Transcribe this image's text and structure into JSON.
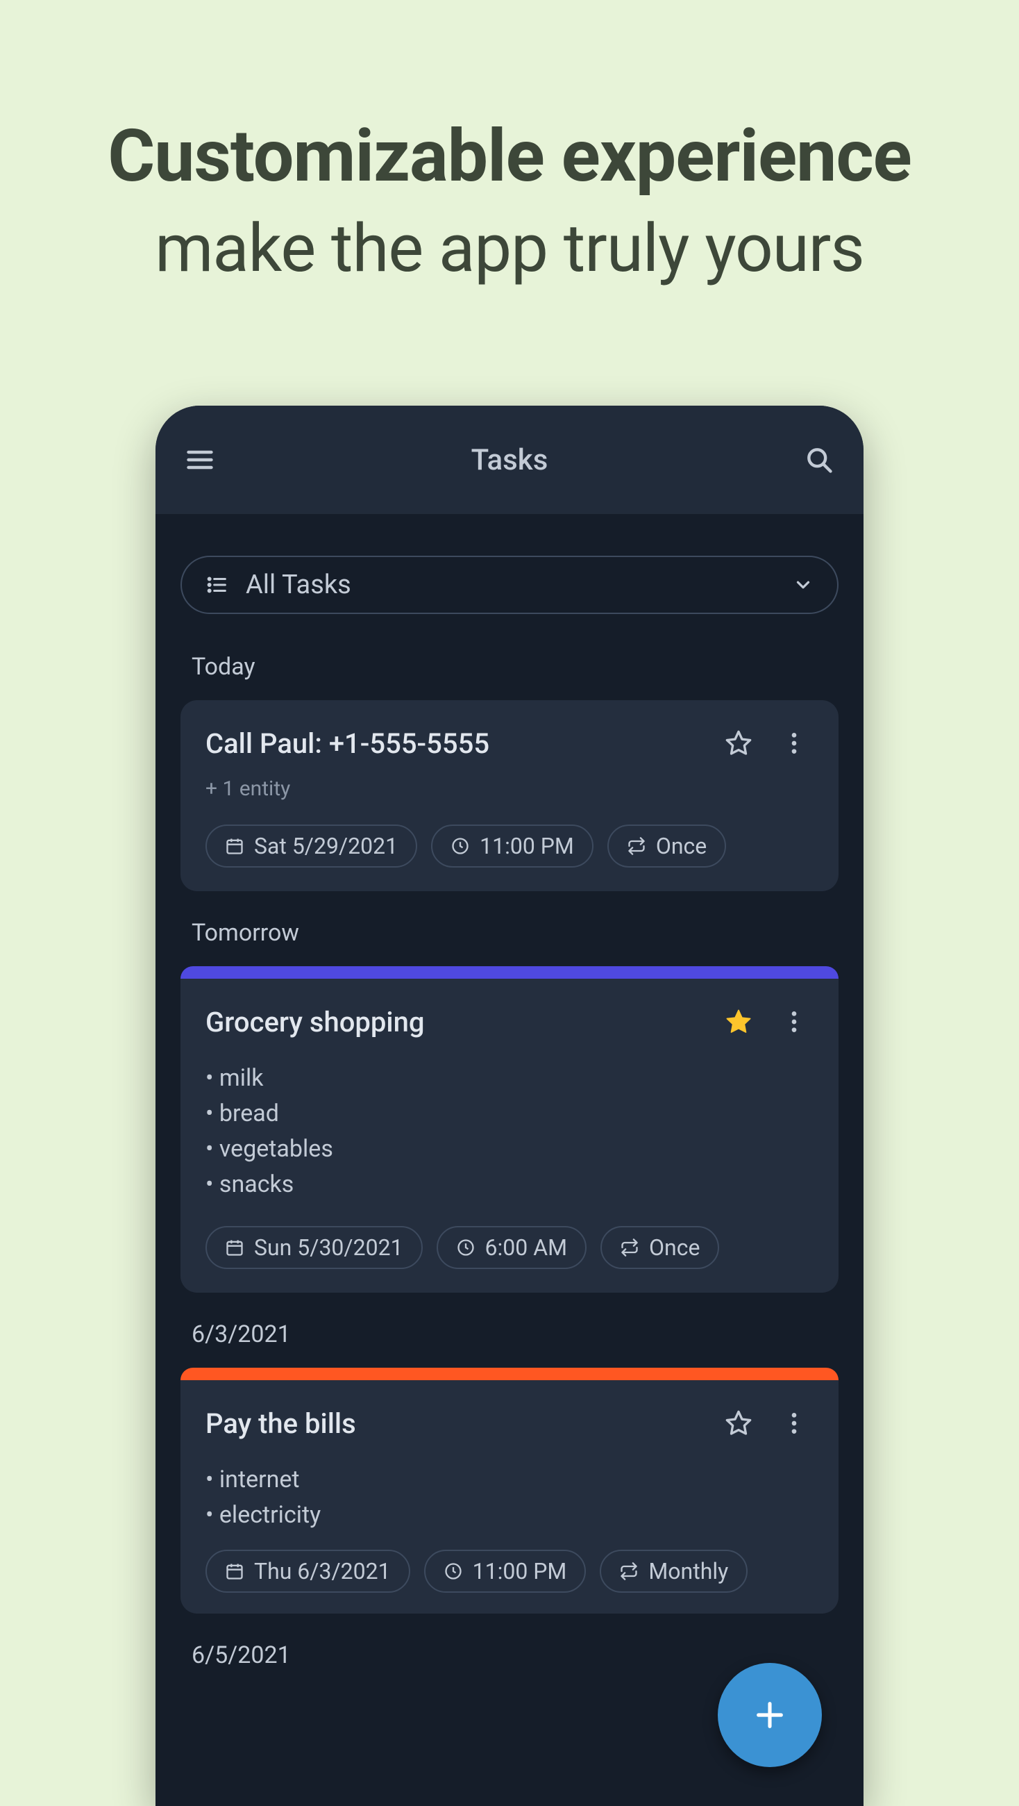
{
  "promo": {
    "line1": "Customizable experience",
    "line2": "make the app truly yours"
  },
  "appBar": {
    "title": "Tasks"
  },
  "filter": {
    "label": "All Tasks"
  },
  "colors": {
    "accentPurple": "#4f49e0",
    "accentOrange": "#ff5722",
    "starActive": "#fdc52c",
    "fab": "#3b92d3"
  },
  "sections": [
    {
      "header": "Today",
      "cards": [
        {
          "title": "Call Paul: +1-555-5555",
          "subtitle": "+ 1 entity",
          "starred": false,
          "accent": null,
          "bullets": [],
          "chips": {
            "date": "Sat 5/29/2021",
            "time": "11:00 PM",
            "repeat": "Once"
          }
        }
      ]
    },
    {
      "header": "Tomorrow",
      "cards": [
        {
          "title": "Grocery shopping",
          "subtitle": "",
          "starred": true,
          "accent": "purple",
          "bullets": [
            "milk",
            "bread",
            "vegetables",
            "snacks"
          ],
          "chips": {
            "date": "Sun 5/30/2021",
            "time": "6:00 AM",
            "repeat": "Once"
          }
        }
      ]
    },
    {
      "header": "6/3/2021",
      "cards": [
        {
          "title": "Pay the bills",
          "subtitle": "",
          "starred": false,
          "accent": "orange",
          "bullets": [
            "internet",
            "electricity"
          ],
          "chips": {
            "date": "Thu 6/3/2021",
            "time": "11:00 PM",
            "repeat": "Monthly"
          }
        }
      ]
    },
    {
      "header": "6/5/2021",
      "cards": []
    }
  ]
}
